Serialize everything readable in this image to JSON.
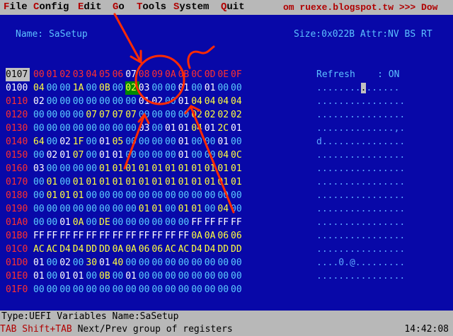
{
  "menu": [
    {
      "hot": "F",
      "rest": "ile",
      "label": "File"
    },
    {
      "hot": "C",
      "rest": "onfig",
      "label": "Config"
    },
    {
      "hot": "E",
      "rest": "dit",
      "label": "Edit"
    },
    {
      "hot": "G",
      "rest": "o",
      "label": "Go"
    },
    {
      "hot": "T",
      "rest": "ools",
      "label": "Tools"
    },
    {
      "hot": "S",
      "rest": "ystem",
      "label": "System"
    },
    {
      "hot": "Q",
      "rest": "uit",
      "label": "Quit"
    }
  ],
  "site_text": "om ruexe.blogspot.tw    >>> Dow",
  "header": {
    "name": "Name: SaSetup",
    "size_attr": "Size:0x022B Attr:NV BS RT"
  },
  "col_header": {
    "addr": "0107",
    "cols": [
      "00",
      "01",
      "02",
      "03",
      "04",
      "05",
      "06",
      "07",
      "08",
      "09",
      "0A",
      "0B",
      "0C",
      "0D",
      "0E",
      "0F"
    ]
  },
  "refresh": "Refresh    : ON",
  "rows": [
    {
      "addr": "0100",
      "bytes": [
        "04",
        "00",
        "00",
        "1A",
        "00",
        "0B",
        "00",
        "02",
        "03",
        "00",
        "00",
        "01",
        "00",
        "01",
        "00",
        "00"
      ],
      "colors": [
        "y",
        "c",
        "c",
        "y",
        "c",
        "y",
        "c",
        "g",
        "w",
        "c",
        "c",
        "w",
        "c",
        "w",
        "c",
        "c"
      ],
      "ascii": "........▮......"
    },
    {
      "addr": "0110",
      "bytes": [
        "02",
        "00",
        "00",
        "00",
        "00",
        "00",
        "00",
        "00",
        "01",
        "02",
        "00",
        "01",
        "04",
        "04",
        "04",
        "04"
      ],
      "colors": [
        "w",
        "c",
        "c",
        "c",
        "c",
        "c",
        "c",
        "c",
        "w",
        "w",
        "c",
        "w",
        "y",
        "y",
        "y",
        "y"
      ],
      "ascii": "................"
    },
    {
      "addr": "0120",
      "bytes": [
        "00",
        "00",
        "00",
        "00",
        "07",
        "07",
        "07",
        "07",
        "00",
        "00",
        "00",
        "00",
        "02",
        "02",
        "02",
        "02"
      ],
      "colors": [
        "c",
        "c",
        "c",
        "c",
        "y",
        "y",
        "y",
        "y",
        "c",
        "c",
        "c",
        "c",
        "y",
        "y",
        "y",
        "y"
      ],
      "ascii": "................"
    },
    {
      "addr": "0130",
      "bytes": [
        "00",
        "00",
        "00",
        "00",
        "00",
        "00",
        "00",
        "00",
        "03",
        "00",
        "01",
        "01",
        "04",
        "01",
        "2C",
        "01"
      ],
      "colors": [
        "c",
        "c",
        "c",
        "c",
        "c",
        "c",
        "c",
        "c",
        "w",
        "c",
        "w",
        "w",
        "y",
        "w",
        "y",
        "w"
      ],
      "ascii": "..............,."
    },
    {
      "addr": "0140",
      "bytes": [
        "64",
        "00",
        "02",
        "1F",
        "00",
        "01",
        "05",
        "00",
        "00",
        "00",
        "00",
        "01",
        "00",
        "00",
        "01",
        "00"
      ],
      "colors": [
        "y",
        "c",
        "w",
        "y",
        "c",
        "w",
        "y",
        "c",
        "c",
        "c",
        "c",
        "w",
        "c",
        "c",
        "w",
        "c"
      ],
      "ascii": "d..............."
    },
    {
      "addr": "0150",
      "bytes": [
        "00",
        "02",
        "01",
        "07",
        "00",
        "01",
        "01",
        "00",
        "00",
        "00",
        "00",
        "01",
        "00",
        "00",
        "04",
        "0C"
      ],
      "colors": [
        "c",
        "w",
        "w",
        "y",
        "c",
        "w",
        "w",
        "c",
        "c",
        "c",
        "c",
        "w",
        "c",
        "c",
        "y",
        "y"
      ],
      "ascii": "................"
    },
    {
      "addr": "0160",
      "bytes": [
        "03",
        "00",
        "00",
        "00",
        "00",
        "01",
        "01",
        "01",
        "01",
        "01",
        "01",
        "01",
        "01",
        "01",
        "01",
        "01"
      ],
      "colors": [
        "w",
        "c",
        "c",
        "c",
        "c",
        "y",
        "y",
        "y",
        "y",
        "y",
        "y",
        "y",
        "y",
        "y",
        "y",
        "y"
      ],
      "ascii": "................"
    },
    {
      "addr": "0170",
      "bytes": [
        "00",
        "01",
        "00",
        "01",
        "01",
        "01",
        "01",
        "01",
        "01",
        "01",
        "01",
        "01",
        "01",
        "01",
        "01",
        "01"
      ],
      "colors": [
        "c",
        "y",
        "c",
        "y",
        "y",
        "y",
        "y",
        "y",
        "y",
        "y",
        "y",
        "y",
        "y",
        "y",
        "y",
        "y"
      ],
      "ascii": "................"
    },
    {
      "addr": "0180",
      "bytes": [
        "00",
        "01",
        "01",
        "01",
        "00",
        "00",
        "00",
        "00",
        "00",
        "00",
        "00",
        "00",
        "00",
        "00",
        "00",
        "00"
      ],
      "colors": [
        "c",
        "y",
        "y",
        "y",
        "c",
        "c",
        "c",
        "c",
        "c",
        "c",
        "c",
        "c",
        "c",
        "c",
        "c",
        "c"
      ],
      "ascii": "................"
    },
    {
      "addr": "0190",
      "bytes": [
        "00",
        "00",
        "00",
        "00",
        "00",
        "00",
        "00",
        "00",
        "01",
        "01",
        "00",
        "01",
        "01",
        "00",
        "04",
        "00"
      ],
      "colors": [
        "c",
        "c",
        "c",
        "c",
        "c",
        "c",
        "c",
        "c",
        "y",
        "y",
        "c",
        "y",
        "y",
        "c",
        "y",
        "c"
      ],
      "ascii": "................"
    },
    {
      "addr": "01A0",
      "bytes": [
        "00",
        "00",
        "01",
        "0A",
        "00",
        "DE",
        "00",
        "00",
        "00",
        "00",
        "00",
        "00",
        "FF",
        "FF",
        "FF",
        "FF"
      ],
      "colors": [
        "c",
        "c",
        "w",
        "y",
        "c",
        "y",
        "c",
        "c",
        "c",
        "c",
        "c",
        "c",
        "w",
        "w",
        "w",
        "w"
      ],
      "ascii": "................"
    },
    {
      "addr": "01B0",
      "bytes": [
        "FF",
        "FF",
        "FF",
        "FF",
        "FF",
        "FF",
        "FF",
        "FF",
        "FF",
        "FF",
        "FF",
        "FF",
        "0A",
        "0A",
        "06",
        "06"
      ],
      "colors": [
        "w",
        "w",
        "w",
        "w",
        "w",
        "w",
        "w",
        "w",
        "w",
        "w",
        "w",
        "w",
        "y",
        "y",
        "y",
        "y"
      ],
      "ascii": "................"
    },
    {
      "addr": "01C0",
      "bytes": [
        "AC",
        "AC",
        "D4",
        "D4",
        "DD",
        "DD",
        "0A",
        "0A",
        "06",
        "06",
        "AC",
        "AC",
        "D4",
        "D4",
        "DD",
        "DD"
      ],
      "colors": [
        "y",
        "y",
        "y",
        "y",
        "y",
        "y",
        "y",
        "y",
        "y",
        "y",
        "y",
        "y",
        "y",
        "y",
        "y",
        "y"
      ],
      "ascii": "................"
    },
    {
      "addr": "01D0",
      "bytes": [
        "01",
        "00",
        "02",
        "00",
        "30",
        "01",
        "40",
        "00",
        "00",
        "00",
        "00",
        "00",
        "00",
        "00",
        "00",
        "00"
      ],
      "colors": [
        "w",
        "c",
        "w",
        "c",
        "y",
        "w",
        "y",
        "c",
        "c",
        "c",
        "c",
        "c",
        "c",
        "c",
        "c",
        "c"
      ],
      "ascii": "....0.@........."
    },
    {
      "addr": "01E0",
      "bytes": [
        "01",
        "00",
        "01",
        "01",
        "00",
        "0B",
        "00",
        "01",
        "00",
        "00",
        "00",
        "00",
        "00",
        "00",
        "00",
        "00"
      ],
      "colors": [
        "w",
        "c",
        "w",
        "w",
        "c",
        "y",
        "c",
        "w",
        "c",
        "c",
        "c",
        "c",
        "c",
        "c",
        "c",
        "c"
      ],
      "ascii": "................"
    },
    {
      "addr": "01F0",
      "bytes": [
        "00",
        "00",
        "00",
        "00",
        "00",
        "00",
        "00",
        "00",
        "00",
        "00",
        "00",
        "00",
        "00",
        "00",
        "00",
        "00"
      ],
      "colors": [
        "c",
        "c",
        "c",
        "c",
        "c",
        "c",
        "c",
        "c",
        "c",
        "c",
        "c",
        "c",
        "c",
        "c",
        "c",
        "c"
      ],
      "ascii": "                "
    }
  ],
  "status": {
    "type_line": "Type:UEFI Variables  Name:SaSetup",
    "key": "TAB Shift+TAB",
    "hint": " Next/Prev group of registers",
    "time": "14:42:08"
  },
  "colors": {
    "background": "#0808a8",
    "menubar": "#b8b8b8",
    "red": "#ff3030",
    "yellow": "#ffff40",
    "white": "#ffffff",
    "cyan": "#5ccbff",
    "annotation": "#ff2000"
  }
}
